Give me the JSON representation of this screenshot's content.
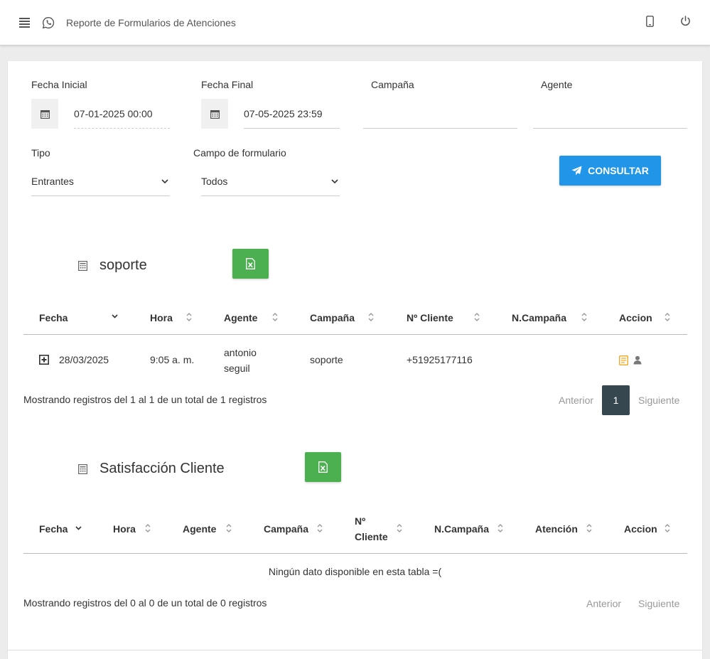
{
  "header": {
    "title": "Reporte de Formularios de Atenciones",
    "icons": [
      "menu-icon",
      "whatsapp-icon",
      "phone-icon",
      "power-icon"
    ]
  },
  "filters": {
    "fecha_inicial_label": "Fecha Inicial",
    "fecha_inicial_value": "07-01-2025 00:00",
    "fecha_final_label": "Fecha Final",
    "fecha_final_value": "07-05-2025 23:59",
    "campana_label": "Campaña",
    "agente_label": "Agente",
    "tipo_label": "Tipo",
    "tipo_value": "Entrantes",
    "campo_label": "Campo de formulario",
    "campo_value": "Todos",
    "consultar_label": "CONSULTAR"
  },
  "section1": {
    "title": "soporte",
    "columns": [
      "Fecha",
      "Hora",
      "Agente",
      "Campaña",
      "Nº Cliente",
      "N.Campaña",
      "Accion"
    ],
    "rows": [
      {
        "fecha": "28/03/2025",
        "hora": "9:05 a. m.",
        "agente_line1": "antonio",
        "agente_line2": "seguil",
        "campana": "soporte",
        "cliente": "+51925177116",
        "n_campana": ""
      }
    ],
    "info": "Mostrando registros del 1 al 1 de un total de 1 registros",
    "prev": "Anterior",
    "page": "1",
    "next": "Siguiente"
  },
  "section2": {
    "title": "Satisfacción Cliente",
    "columns": [
      "Fecha",
      "Hora",
      "Agente",
      "Campaña",
      "Nº",
      "Cliente",
      "N.Campaña",
      "Atención",
      "Accion"
    ],
    "empty": "Ningún dato disponible en esta tabla =(",
    "info": "Mostrando registros del 0 al 0 de un total de 0 registros",
    "prev": "Anterior",
    "next": "Siguiente"
  },
  "colors": {
    "primary": "#2196e8",
    "excel": "#4caf50",
    "page_active": "#37474f",
    "action_orange": "#f5a623"
  }
}
